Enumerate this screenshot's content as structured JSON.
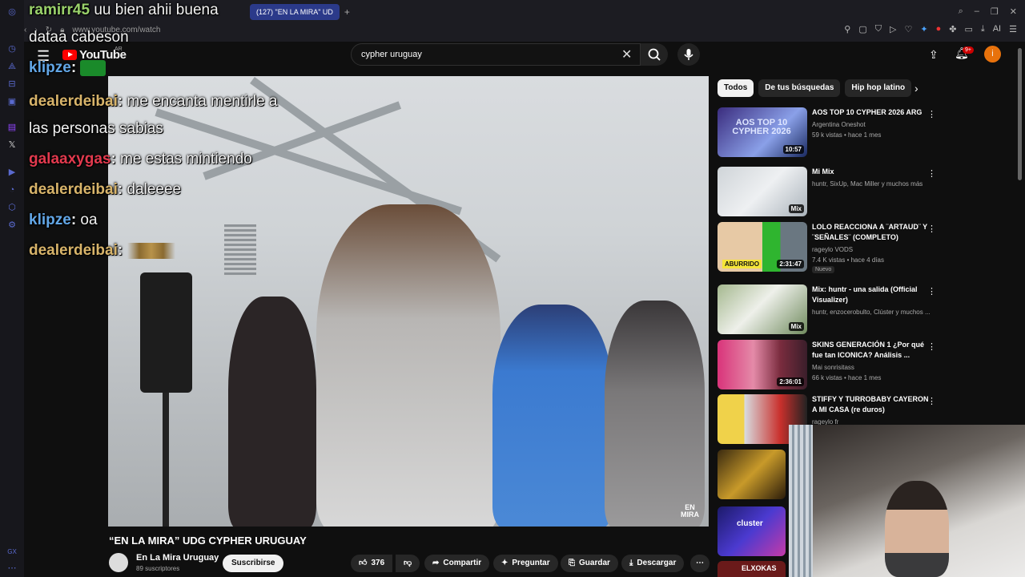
{
  "browser": {
    "tabs": [
      {
        "label": "ramirr45 uu bien ahii buena"
      },
      {
        "label": "(127) \"EN LA MIRA\" UD",
        "active": true
      }
    ],
    "url": "www.youtube.com/watch",
    "new_tab": "+"
  },
  "header": {
    "logo_text": "YouTube",
    "country": "AR",
    "search_value": "cypher uruguay",
    "notification_count": "9+",
    "avatar_letter": "i"
  },
  "video": {
    "title": "“EN LA MIRA” UDG CYPHER URUGUAY",
    "watermark_line1": "EN",
    "watermark_line2": "MIRA",
    "channel": "En La Mira Uruguay",
    "subscribers": "89 suscriptores",
    "subscribe_label": "Suscribirse",
    "likes": "376",
    "share_label": "Compartir",
    "ask_label": "Preguntar",
    "save_label": "Guardar",
    "download_label": "Descargar"
  },
  "chips": [
    "Todos",
    "De tus búsquedas",
    "Hip hop latino"
  ],
  "recommendations": [
    {
      "title": "AOS TOP 10 CYPHER 2026 ARG",
      "channel": "Argentina Oneshot",
      "meta": "59 k vistas • hace 1 mes",
      "duration": "10:57",
      "thumb_text": "AOS TOP 10 CYPHER 2026"
    },
    {
      "title": "Mi Mix",
      "channel": "huntr, SixUp, Mac Miller y muchos más",
      "meta": "",
      "duration": "Mix"
    },
    {
      "title": "LOLO REACCIONA A ¨ARTAUD¨ Y ¨SEÑALES¨ (COMPLETO)",
      "channel": "rageylo VODS",
      "meta": "7.4 K vistas • hace 4 días",
      "duration": "2:31:47",
      "badge": "Nuevo",
      "thumb_text": "ABURRIDO"
    },
    {
      "title": "Mix: huntr - una salida (Official Visualizer)",
      "channel": "huntr, enzocerobulto, Clúster y muchos ...",
      "meta": "",
      "duration": "Mix"
    },
    {
      "title": "SKINS GENERACIÓN 1 ¿Por qué fue tan ICONICA? Análisis ...",
      "channel": "Mai sonrisitass",
      "meta": "66 k vistas • hace 1 mes",
      "duration": "2:36:01"
    },
    {
      "title": "STIFFY Y TURROBABY CAYERON A MI CASA (re duros)",
      "channel": "rageylo fr",
      "meta": "",
      "duration": ""
    }
  ],
  "extra_thumbs": [
    {
      "text": "cluster"
    },
    {
      "text": "ELXOKAS"
    }
  ],
  "chat": [
    {
      "user": "ramirr45",
      "text": " uu bien ahii buena",
      "color": "#9ad26b"
    },
    {
      "user": "",
      "text": "dataa cabeson",
      "color": "#f2f2f2"
    },
    {
      "user": "klipze",
      "text": "",
      "color": "#62a6e6"
    },
    {
      "user": "dealerdeibai",
      "text": " me encanta mentirle a",
      "color": "#d8b46a"
    },
    {
      "user": "",
      "text": "las personas sabias",
      "color": "#f2f2f2"
    },
    {
      "user": "galaaxygas",
      "text": " me estas mintiendo",
      "color": "#e23a4e"
    },
    {
      "user": "dealerdeibai",
      "text": " daleeee",
      "color": "#d8b46a"
    },
    {
      "user": "klipze",
      "text": " oa",
      "color": "#62a6e6"
    },
    {
      "user": "dealerdeibai",
      "text": "",
      "color": "#d8b46a"
    }
  ]
}
